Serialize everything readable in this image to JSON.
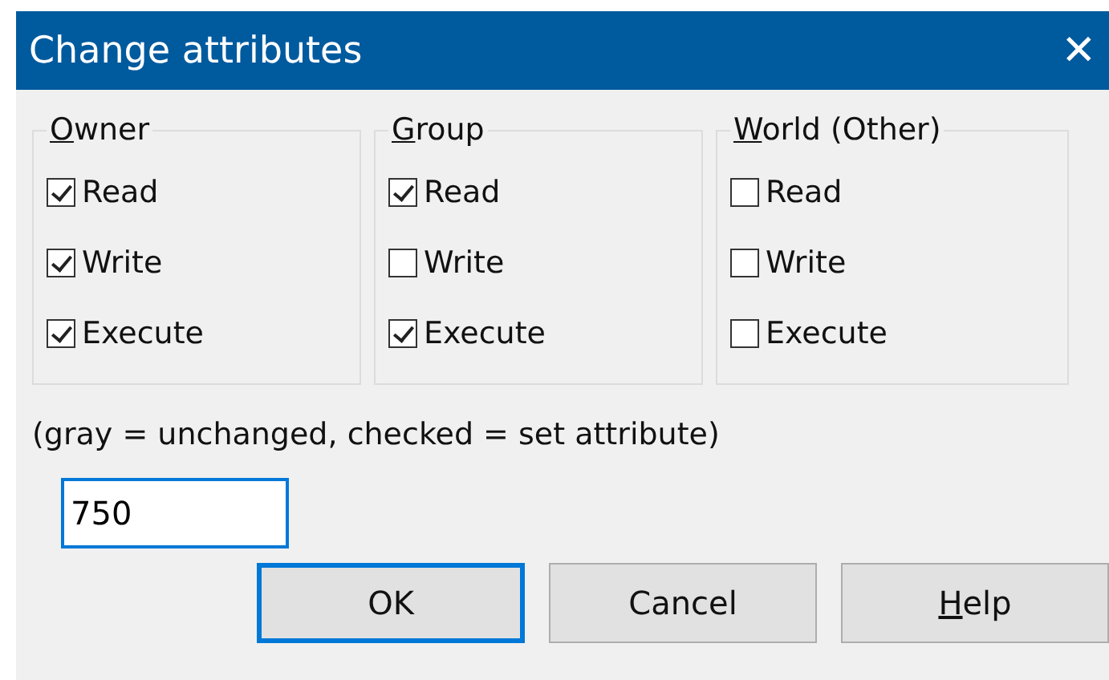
{
  "window": {
    "title": "Change attributes",
    "close": "✕"
  },
  "groups": [
    {
      "label": "Owner",
      "access_key": true,
      "items": [
        {
          "label": "Read",
          "checked": true
        },
        {
          "label": "Write",
          "checked": true
        },
        {
          "label": "Execute",
          "checked": true
        }
      ]
    },
    {
      "label": "Group",
      "access_key": true,
      "items": [
        {
          "label": "Read",
          "checked": true
        },
        {
          "label": "Write",
          "checked": false
        },
        {
          "label": "Execute",
          "checked": true
        }
      ]
    },
    {
      "label": "World (Other)",
      "access_key": true,
      "items": [
        {
          "label": "Read",
          "checked": false
        },
        {
          "label": "Write",
          "checked": false
        },
        {
          "label": "Execute",
          "checked": false
        }
      ]
    }
  ],
  "note": "(gray = unchanged, checked = set attribute)",
  "mode_field": {
    "value": "750",
    "focused": true
  },
  "buttons": [
    {
      "label": "OK",
      "default": true,
      "access_key": false
    },
    {
      "label": "Cancel",
      "default": false,
      "access_key": false
    },
    {
      "label": "Help",
      "default": false,
      "access_key": true
    }
  ]
}
